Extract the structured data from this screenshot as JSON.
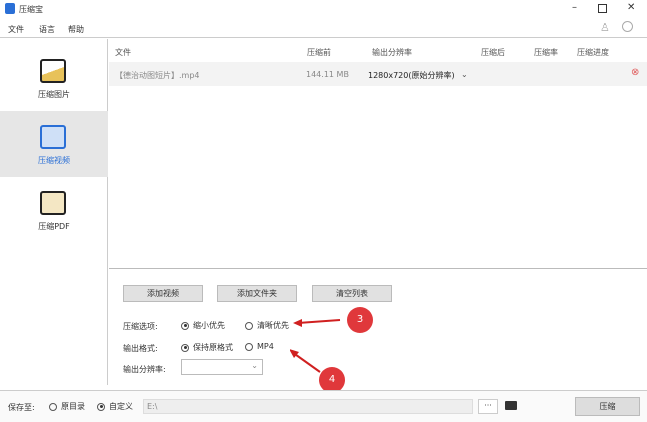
{
  "app": {
    "title": "压缩宝"
  },
  "menu": [
    "文件",
    "语言",
    "帮助"
  ],
  "sidebar": [
    {
      "label": "压缩图片"
    },
    {
      "label": "压缩视频"
    },
    {
      "label": "压缩PDF"
    }
  ],
  "table": {
    "headers": [
      "文件",
      "压缩前",
      "输出分辨率",
      "压缩后",
      "压缩率",
      "压缩进度"
    ],
    "rows": [
      {
        "file": "【德治动图短片】.mp4",
        "before": "144.11 MB",
        "resolution": "1280x720(原始分辨率)"
      }
    ]
  },
  "buttons": {
    "add_video": "添加视频",
    "add_folder": "添加文件夹",
    "clear_list": "清空列表",
    "compress": "压缩",
    "browse": "···"
  },
  "options": {
    "compress_label": "压缩选项:",
    "compress_opts": [
      "缩小优先",
      "清晰优先"
    ],
    "format_label": "输出格式:",
    "format_opts": [
      "保持原格式",
      "MP4"
    ],
    "resolution_label": "输出分辨率:"
  },
  "save": {
    "label": "保存至:",
    "opts": [
      "原目录",
      "自定义"
    ],
    "path": "E:\\"
  },
  "annotations": [
    "3",
    "4"
  ],
  "colors": {
    "annotation": "#e0383b",
    "selected": "#e6e6e6"
  }
}
